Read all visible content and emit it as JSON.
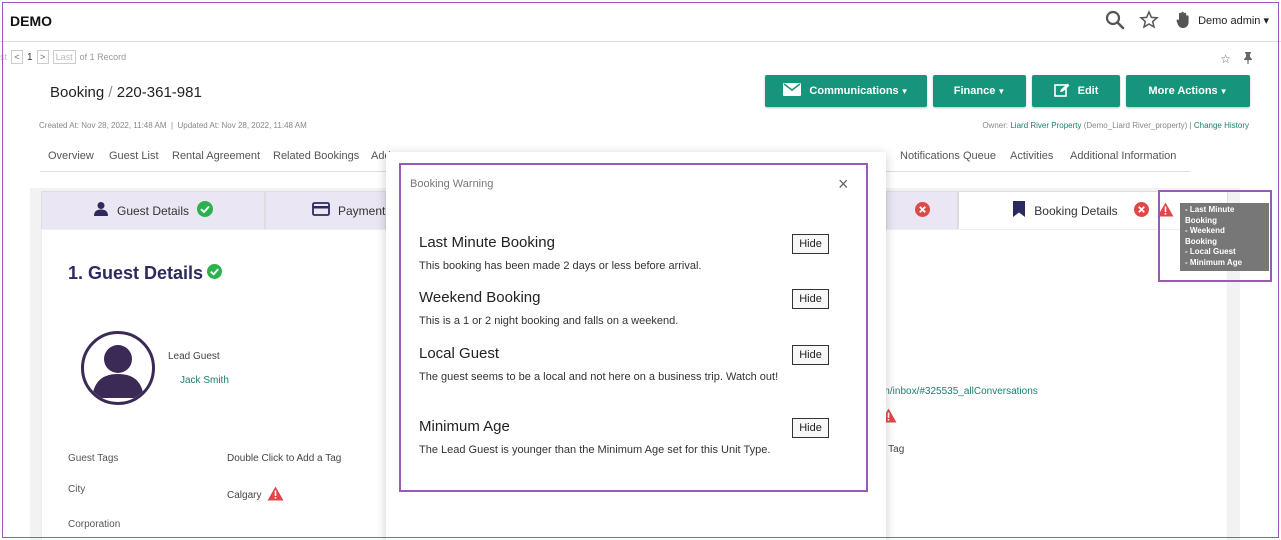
{
  "app": {
    "brand": "DEMO",
    "user": "Demo admin"
  },
  "pager": {
    "first": "st",
    "prev": "<",
    "page": "1",
    "next": ">",
    "last": "Last",
    "count": "of 1 Record"
  },
  "booking": {
    "label": "Booking",
    "separator": "/",
    "number": "220-361-981",
    "created": "Created At: Nov 28, 2022, 11:48 AM",
    "updated": "Updated At: Nov 28, 2022, 11:48 AM",
    "owner_prefix": "Owner:",
    "owner_link": "Liard River Property",
    "owner_suffix": "(Demo_Liard River_property)",
    "change_history": "Change History"
  },
  "actions": [
    "Communications",
    "Finance",
    "Edit",
    "More Actions"
  ],
  "nav_tabs": [
    "Overview",
    "Guest List",
    "Rental Agreement",
    "Related Bookings",
    "Add",
    "Notifications Queue",
    "Activities",
    "Additional Information"
  ],
  "step_tabs": {
    "guest_details": "Guest Details",
    "payment": "Payment",
    "booking_details": "Booking Details"
  },
  "guest": {
    "heading": "1. Guest Details",
    "lead_label": "Lead Guest",
    "lead_name": "Jack Smith",
    "tags_label": "Guest Tags",
    "tags_value": "Double Click to Add a Tag",
    "city_label": "City",
    "city_value": "Calgary",
    "corp_label": "Corporation"
  },
  "background_snippets": {
    "inbox": "om/inbox/#325535_allConversations",
    "tag": "a Tag"
  },
  "modal": {
    "title": "Booking Warning",
    "close": "×",
    "hide_label": "Hide",
    "warnings": [
      {
        "title": "Last Minute Booking",
        "desc": "This booking has been made 2 days or less before arrival."
      },
      {
        "title": "Weekend Booking",
        "desc": "This is a 1 or 2 night booking and falls on a weekend."
      },
      {
        "title": "Local Guest",
        "desc": "The guest seems to be a local and not here on a business trip. Watch out!"
      },
      {
        "title": "Minimum Age",
        "desc": "The Lead Guest is younger than the Minimum Age set for this Unit Type."
      }
    ]
  },
  "tooltip": [
    "- Last Minute",
    "Booking",
    "- Weekend",
    "Booking",
    "- Local Guest",
    "- Minimum Age"
  ],
  "colors": {
    "accent": "#17957c",
    "highlight": "#9b59b6",
    "heading": "#2c2a5e",
    "success": "#2bb24c",
    "danger": "#e04848"
  }
}
